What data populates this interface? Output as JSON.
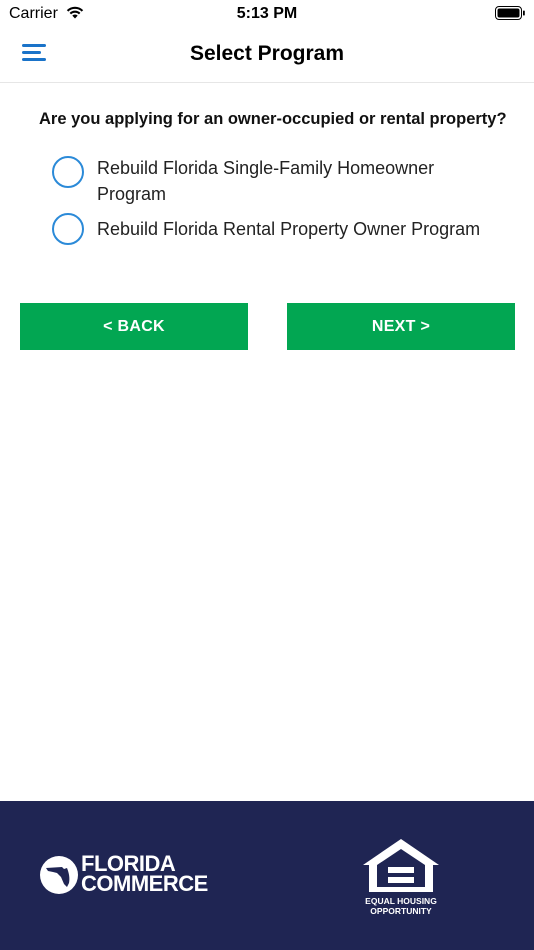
{
  "status_bar": {
    "carrier": "Carrier",
    "time": "5:13 PM"
  },
  "nav": {
    "title": "Select Program",
    "menu_icon": "hamburger-menu-icon"
  },
  "form": {
    "question": "Are you applying for an owner-occupied or rental property?",
    "options": [
      {
        "label": "Rebuild Florida Single-Family Homeowner Program",
        "selected": false
      },
      {
        "label": "Rebuild Florida Rental Property Owner Program",
        "selected": false
      }
    ]
  },
  "buttons": {
    "back_label": "< BACK",
    "next_label": "NEXT >"
  },
  "footer": {
    "left_logo_line1": "FLORIDA",
    "left_logo_line2": "COMMERCE",
    "right_logo_line1": "EQUAL HOUSING",
    "right_logo_line2": "OPPORTUNITY"
  },
  "colors": {
    "accent_blue": "#1a73c9",
    "radio_blue": "#2b8ad8",
    "button_green": "#02a652",
    "footer_navy": "#1f2553"
  }
}
